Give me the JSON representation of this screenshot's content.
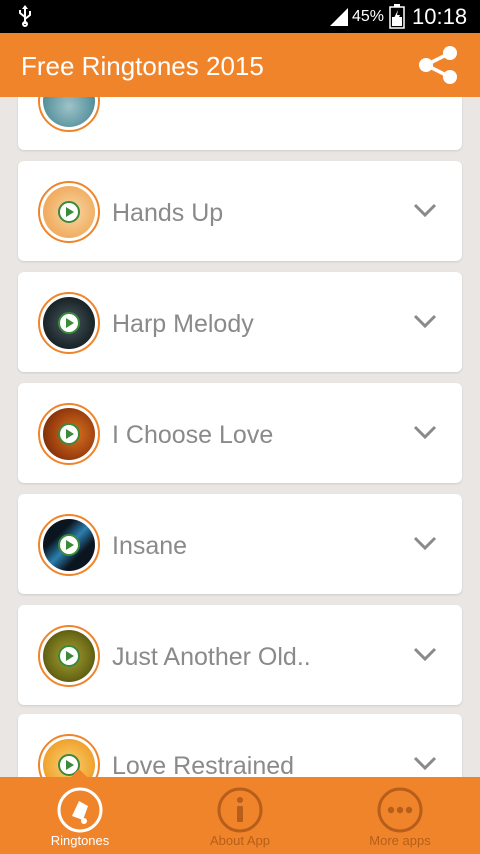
{
  "status_bar": {
    "battery_percent": "45%",
    "time": "10:18",
    "icons": [
      "usb-icon",
      "signal-icon",
      "battery-icon"
    ]
  },
  "app_bar": {
    "title": "Free Ringtones 2015",
    "share_icon": "share-icon"
  },
  "ringtones": [
    {
      "title": "",
      "icon": "play-icon",
      "expand_icon": "chevron-down-icon"
    },
    {
      "title": "Hands Up",
      "icon": "play-icon",
      "expand_icon": "chevron-down-icon"
    },
    {
      "title": "Harp Melody",
      "icon": "play-icon",
      "expand_icon": "chevron-down-icon"
    },
    {
      "title": "I Choose Love",
      "icon": "play-icon",
      "expand_icon": "chevron-down-icon"
    },
    {
      "title": "Insane",
      "icon": "play-icon",
      "expand_icon": "chevron-down-icon"
    },
    {
      "title": "Just Another Old..",
      "icon": "play-icon",
      "expand_icon": "chevron-down-icon"
    },
    {
      "title": "Love Restrained",
      "icon": "play-icon",
      "expand_icon": "chevron-down-icon"
    }
  ],
  "bottom_nav": {
    "items": [
      {
        "label": "Ringtones",
        "icon": "ringtones-icon",
        "active": true
      },
      {
        "label": "About App",
        "icon": "info-icon",
        "active": false
      },
      {
        "label": "More apps",
        "icon": "more-icon",
        "active": false
      }
    ]
  },
  "colors": {
    "accent": "#f0842a",
    "inactive_nav": "#b65e1a",
    "title_text": "#8a8a8a",
    "play_green": "#3a8a3a"
  }
}
